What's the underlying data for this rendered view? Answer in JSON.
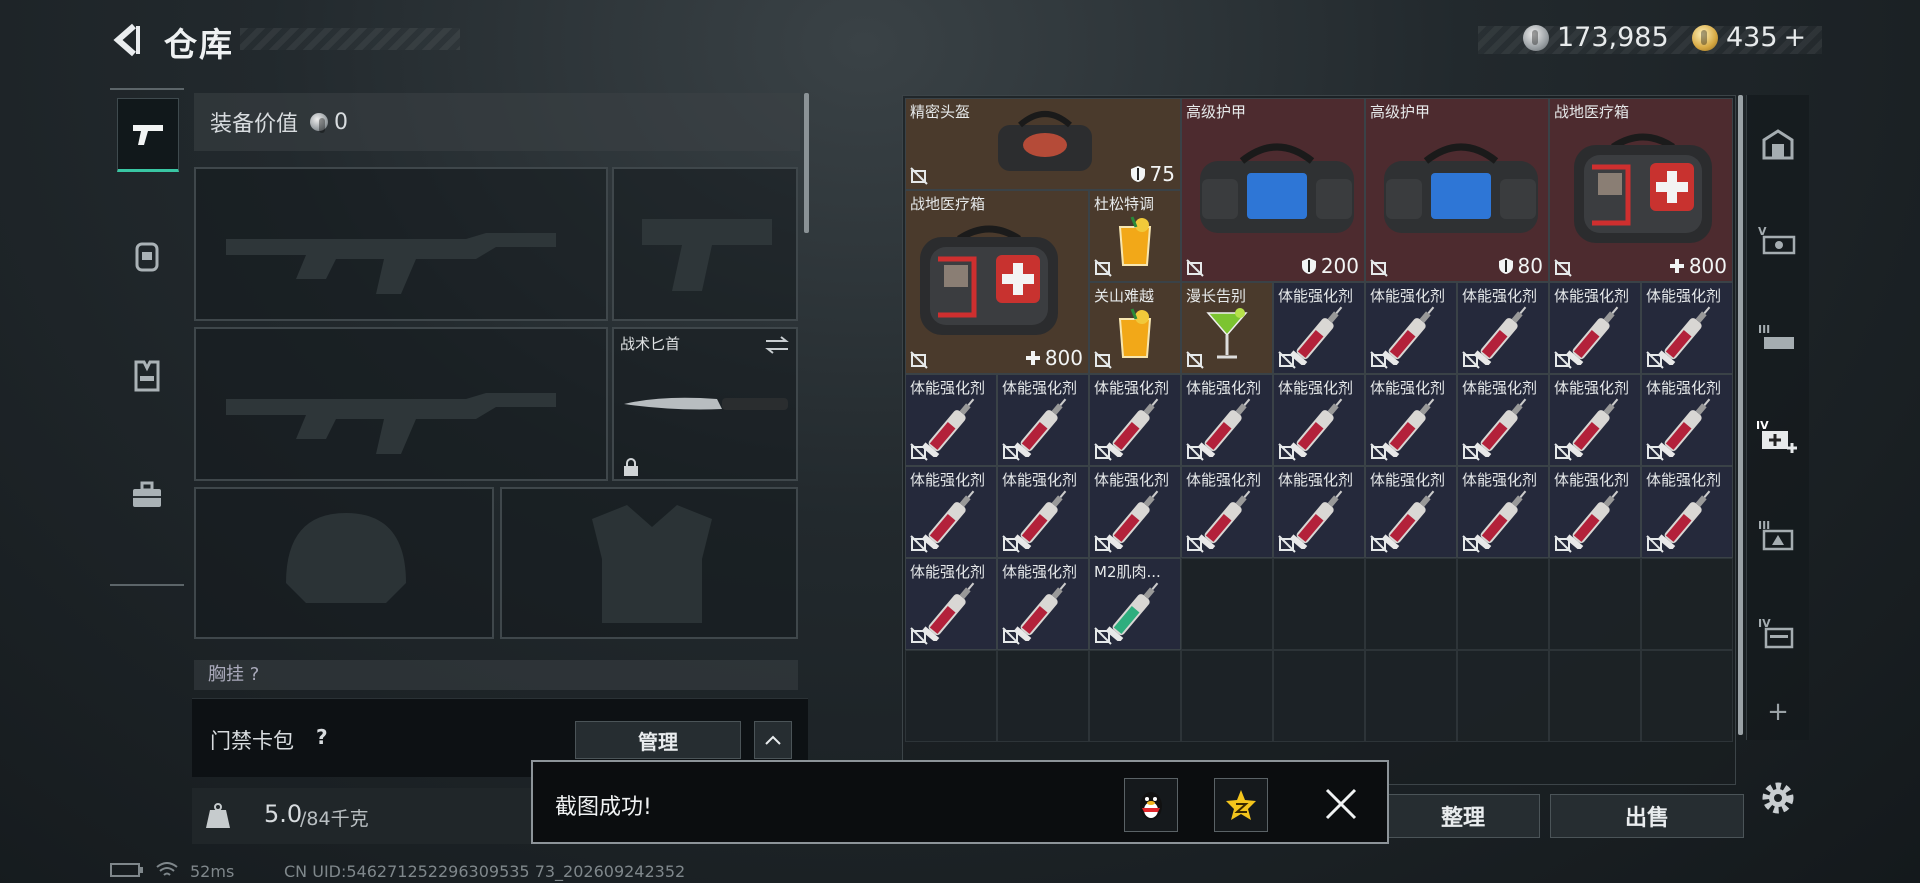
{
  "header": {
    "title": "仓库"
  },
  "currency": {
    "silver": "173,985",
    "gold": "435",
    "gold_add": "+"
  },
  "equip": {
    "value_label": "装备价值",
    "value": "0",
    "knife_label": "战术匕首",
    "chest_label": "胸挂 ?"
  },
  "keycard": {
    "label": "门禁卡包",
    "help": "?",
    "manage": "管理"
  },
  "weight": {
    "current": "5.0",
    "max": "/84千克",
    "icon_label": "KG"
  },
  "inventory": {
    "items": [
      {
        "name": "精密头盔",
        "value": "75",
        "value_icon": "shield-icon",
        "color": "brown",
        "icon": "bag-icon"
      },
      {
        "name": "高级护甲",
        "value": "200",
        "value_icon": "shield-icon",
        "color": "red",
        "icon": "armor-bag-icon"
      },
      {
        "name": "高级护甲",
        "value": "80",
        "value_icon": "shield-icon",
        "color": "red",
        "icon": "armor-bag-icon"
      },
      {
        "name": "战地医疗箱",
        "value": "800",
        "value_icon": "plus-icon",
        "color": "red",
        "icon": "medkit-icon"
      },
      {
        "name": "战地医疗箱",
        "value": "800",
        "value_icon": "plus-icon",
        "color": "brown",
        "icon": "medkit-icon"
      },
      {
        "name": "杜松特调",
        "value": "",
        "color": "brown",
        "icon": "cocktail-icon"
      },
      {
        "name": "关山难越",
        "value": "",
        "color": "brown",
        "icon": "cocktail-icon"
      },
      {
        "name": "漫长告别",
        "value": "",
        "color": "brown",
        "icon": "martini-icon"
      },
      {
        "name": "体能强化剂",
        "value": "",
        "color": "blue",
        "icon": "syringe-icon"
      },
      {
        "name": "M2肌肉...",
        "value": "",
        "color": "blue",
        "icon": "syringe-green-icon"
      }
    ]
  },
  "actions": {
    "sort": "整理",
    "sell": "出售",
    "add": "+"
  },
  "toast": {
    "message": "截图成功!"
  },
  "status": {
    "ping": "52ms",
    "uid": "CN UID:546271252296309535 73_202609242352"
  },
  "colors": {
    "accent": "#39c6a3",
    "item_blue": "#25293b",
    "item_brown": "#4a3a2c",
    "item_red": "#4d2b2f"
  }
}
